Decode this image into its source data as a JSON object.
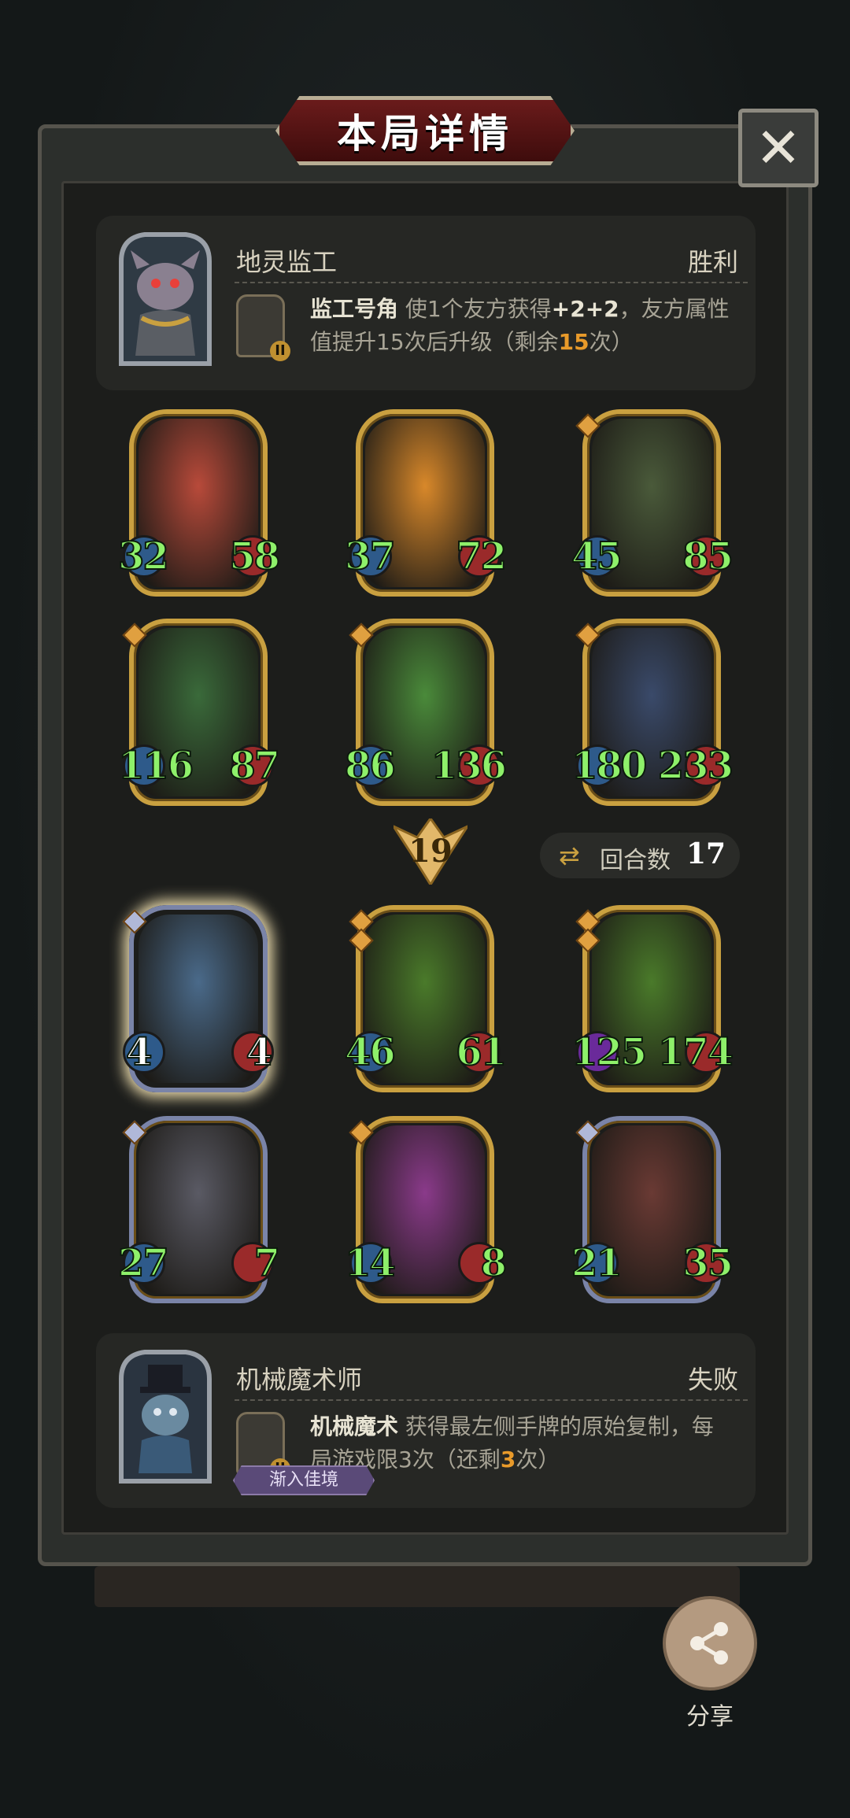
{
  "header": {
    "title": "本局详情",
    "close_symbol": "✕"
  },
  "top_player": {
    "name": "地灵监工",
    "result": "胜利",
    "skill_level": "II",
    "skill_name": "监工号角",
    "skill_desc_1": "使1个友方获得",
    "skill_bonus": "+2+2",
    "skill_desc_2": "，友方属性值提升15次后升级（剩余",
    "skill_remaining": "15",
    "skill_desc_3": "次）"
  },
  "top_cards": [
    {
      "atk": "32",
      "hp": "58",
      "art_color": "#b84a3a"
    },
    {
      "atk": "37",
      "hp": "72",
      "art_color": "#d8882a"
    },
    {
      "atk": "45",
      "hp": "85",
      "art_color": "#4a5a3a"
    },
    {
      "atk": "116",
      "hp": "87",
      "art_color": "#3a6a3a"
    },
    {
      "atk": "86",
      "hp": "136",
      "art_color": "#4a8a3a"
    },
    {
      "atk": "180",
      "hp": "233",
      "art_color": "#3a4a6a"
    }
  ],
  "round_info": {
    "round_number": "19",
    "turns_label": "回合数",
    "turns_value": "17"
  },
  "bottom_cards": [
    {
      "atk": "4",
      "hp": "4",
      "art_color": "#4a6a8a"
    },
    {
      "atk": "46",
      "hp": "61",
      "art_color": "#4a7a2a"
    },
    {
      "atk": "125",
      "hp": "174",
      "art_color": "#4a7a2a"
    },
    {
      "atk": "27",
      "hp": "7",
      "art_color": "#5a5a64"
    },
    {
      "atk": "14",
      "hp": "8",
      "art_color": "#8a3a8a"
    },
    {
      "atk": "21",
      "hp": "35",
      "art_color": "#6a3a34"
    }
  ],
  "bottom_player": {
    "name": "机械魔术师",
    "result": "失败",
    "skill_level": "II",
    "skill_name": "机械魔术",
    "skill_desc_1": "获得最左侧手牌的原始复制，每局游戏限3次（还剩",
    "skill_remaining": "3",
    "skill_desc_2": "次）",
    "tag": "渐入佳境"
  },
  "share": {
    "label": "分享"
  },
  "colors": {
    "gold": "#c9a040",
    "stat_green": "#8ef06a",
    "highlight": "#e89a2a",
    "title_red": "#6a1b1b"
  }
}
